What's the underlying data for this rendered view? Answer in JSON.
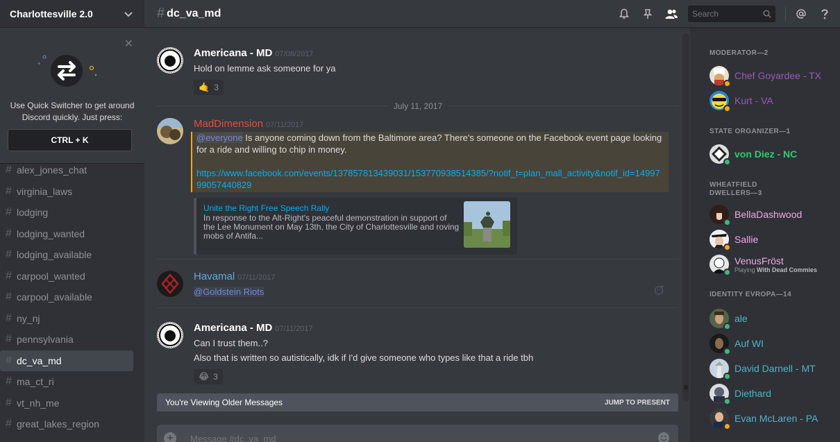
{
  "server": {
    "name": "Charlottesville 2.0"
  },
  "quick_switcher": {
    "text_line1": "Use Quick Switcher to get around",
    "text_line2": "Discord quickly. Just press:",
    "shortcut": "CTRL + K"
  },
  "channels": [
    {
      "name": "alex_jones_chat",
      "active": false
    },
    {
      "name": "virginia_laws",
      "active": false
    },
    {
      "name": "lodging",
      "active": false
    },
    {
      "name": "lodging_wanted",
      "active": false
    },
    {
      "name": "lodging_available",
      "active": false
    },
    {
      "name": "carpool_wanted",
      "active": false
    },
    {
      "name": "carpool_available",
      "active": false
    },
    {
      "name": "ny_nj",
      "active": false
    },
    {
      "name": "pennsylvania",
      "active": false
    },
    {
      "name": "dc_va_md",
      "active": true
    },
    {
      "name": "ma_ct_ri",
      "active": false
    },
    {
      "name": "vt_nh_me",
      "active": false
    },
    {
      "name": "great_lakes_region",
      "active": false
    }
  ],
  "header": {
    "hash": "#",
    "channel": "dc_va_md",
    "search_placeholder": "Search"
  },
  "messages": {
    "m1": {
      "author": "Americana - MD",
      "author_color": "#ffffff",
      "timestamp": "07/08/2017",
      "text": "Hold on lemme ask someone for ya",
      "reaction_count": "3"
    },
    "date_divider": "July 11, 2017",
    "m2": {
      "author": "MadDimension",
      "author_color": "#e74c3c",
      "timestamp": "07/11/2017",
      "mention": "@everyone",
      "text": " Is anyone coming down from the Baltimore area? There's someone on the Facebook event page looking for a ride and willing to chip in money.",
      "link": "https://www.facebook.com/events/137857813439031/153770938514385/?notif_t=plan_mall_activity&notif_id=1499799057440829",
      "embed_title": "Unite the Right Free Speech Rally",
      "embed_desc": "In response to the Alt-Right's peaceful demonstration in support of the Lee Monument on May 13th, the City of Charlottesville and roving mobs of Antifa..."
    },
    "m3": {
      "author": "Havamal",
      "author_color": "#5dade2",
      "timestamp": "07/11/2017",
      "mention": "@Goldstein Riots"
    },
    "m4": {
      "author": "Americana - MD",
      "author_color": "#ffffff",
      "timestamp": "07/11/2017",
      "line1": "Can I trust them..?",
      "line2": "Also that is written so autistically, idk if I'd give someone who types like that a ride tbh",
      "reaction_count": "3"
    }
  },
  "older_bar": {
    "text": "You're Viewing Older Messages",
    "jump": "JUMP TO PRESENT"
  },
  "composer": {
    "placeholder": "Message #dc_va_md"
  },
  "members": {
    "roles": [
      {
        "title": "MODERATOR—2",
        "members": [
          {
            "name": "Chef Goyardee - TX",
            "color": "#9b59b6",
            "status": "idle"
          },
          {
            "name": "Kurt - VA",
            "color": "#9b59b6",
            "status": "idle"
          }
        ]
      },
      {
        "title": "STATE ORGANIZER—1",
        "members": [
          {
            "name": "von Diez - NC",
            "color": "#2ecc71",
            "status": "online"
          }
        ]
      },
      {
        "title_line1": "WHEATFIELD",
        "title_line2": "DWELLERS—3",
        "members": [
          {
            "name": "BellaDashwood",
            "color": "#f1a7e8",
            "status": "online"
          },
          {
            "name": "Sallie",
            "color": "#f1a7e8",
            "status": "idle"
          },
          {
            "name": "VenusFröst",
            "color": "#f1a7e8",
            "status": "online",
            "activity_prefix": "Playing ",
            "activity": "With Dead Commies"
          }
        ]
      },
      {
        "title": "IDENTITY EVROPA—14",
        "members": [
          {
            "name": "ale",
            "color": "#4fb5c8",
            "status": "online"
          },
          {
            "name": "Auf WI",
            "color": "#4fb5c8",
            "status": "online"
          },
          {
            "name": "David Darnell - MT",
            "color": "#4fb5c8",
            "status": "online"
          },
          {
            "name": "Diethard",
            "color": "#4fb5c8",
            "status": "online"
          },
          {
            "name": "Evan McLaren - PA",
            "color": "#4fb5c8",
            "status": "idle"
          }
        ]
      }
    ]
  }
}
